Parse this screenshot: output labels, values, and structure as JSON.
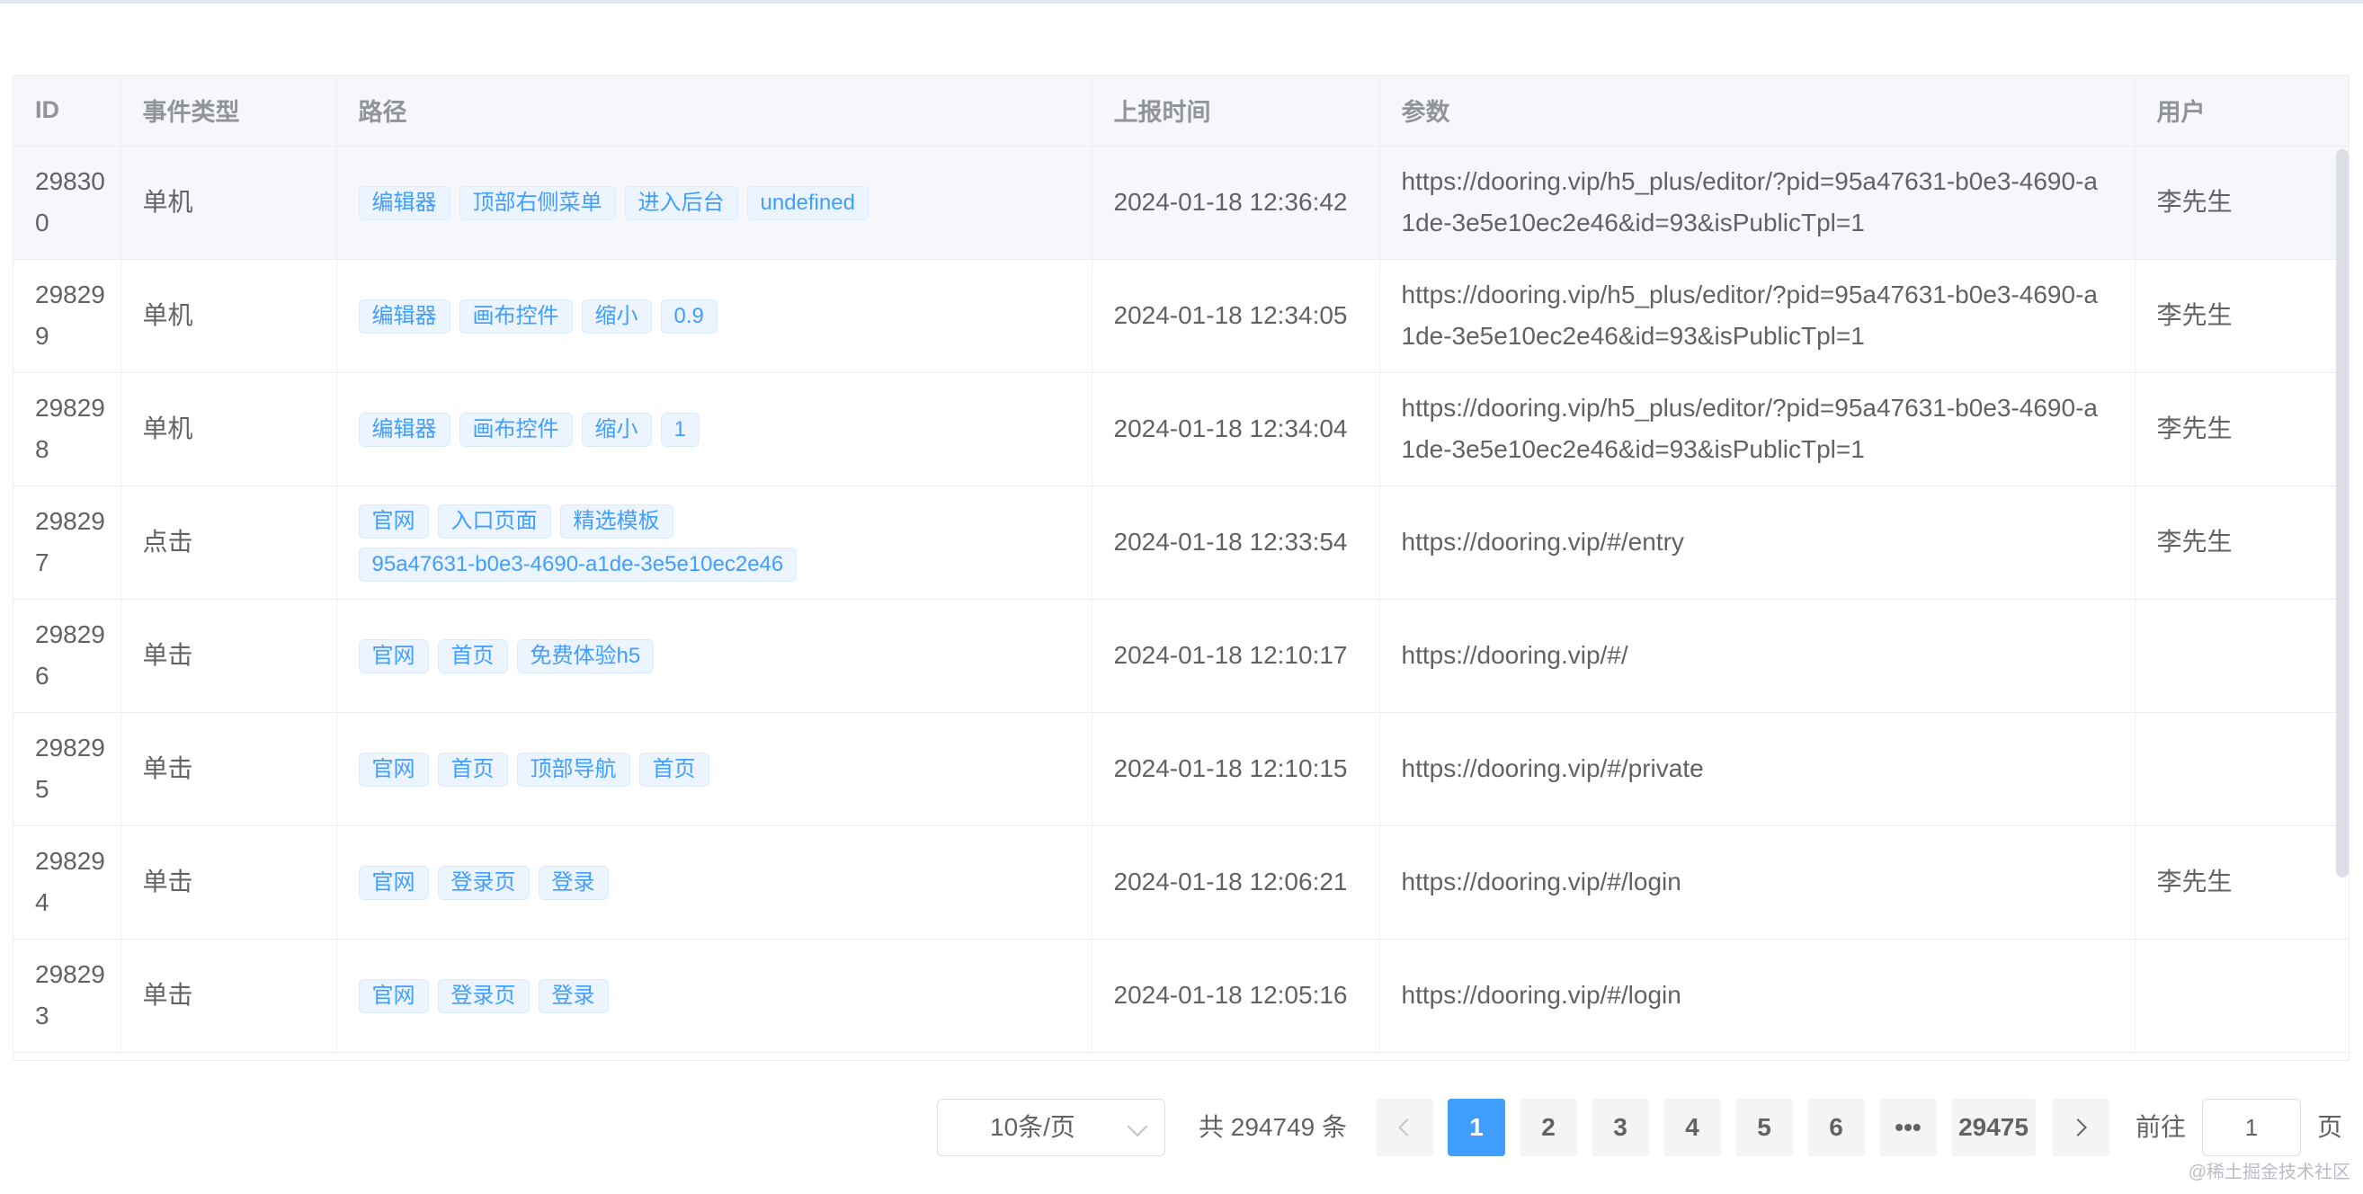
{
  "table": {
    "columns": [
      "ID",
      "事件类型",
      "路径",
      "上报时间",
      "参数",
      "用户"
    ],
    "rows": [
      {
        "id": "298300",
        "type": "单机",
        "path": [
          "编辑器",
          "顶部右侧菜单",
          "进入后台",
          "undefined"
        ],
        "time": "2024-01-18 12:36:42",
        "params": "https://dooring.vip/h5_plus/editor/?pid=95a47631-b0e3-4690-a1de-3e5e10ec2e46&id=93&isPublicTpl=1",
        "user": "李先生"
      },
      {
        "id": "298299",
        "type": "单机",
        "path": [
          "编辑器",
          "画布控件",
          "缩小",
          "0.9"
        ],
        "time": "2024-01-18 12:34:05",
        "params": "https://dooring.vip/h5_plus/editor/?pid=95a47631-b0e3-4690-a1de-3e5e10ec2e46&id=93&isPublicTpl=1",
        "user": "李先生"
      },
      {
        "id": "298298",
        "type": "单机",
        "path": [
          "编辑器",
          "画布控件",
          "缩小",
          "1"
        ],
        "time": "2024-01-18 12:34:04",
        "params": "https://dooring.vip/h5_plus/editor/?pid=95a47631-b0e3-4690-a1de-3e5e10ec2e46&id=93&isPublicTpl=1",
        "user": "李先生"
      },
      {
        "id": "298297",
        "type": "点击",
        "path": [
          "官网",
          "入口页面",
          "精选模板",
          "95a47631-b0e3-4690-a1de-3e5e10ec2e46"
        ],
        "time": "2024-01-18 12:33:54",
        "params": "https://dooring.vip/#/entry",
        "user": "李先生"
      },
      {
        "id": "298296",
        "type": "单击",
        "path": [
          "官网",
          "首页",
          "免费体验h5"
        ],
        "time": "2024-01-18 12:10:17",
        "params": "https://dooring.vip/#/",
        "user": ""
      },
      {
        "id": "298295",
        "type": "单击",
        "path": [
          "官网",
          "首页",
          "顶部导航",
          "首页"
        ],
        "time": "2024-01-18 12:10:15",
        "params": "https://dooring.vip/#/private",
        "user": ""
      },
      {
        "id": "298294",
        "type": "单击",
        "path": [
          "官网",
          "登录页",
          "登录"
        ],
        "time": "2024-01-18 12:06:21",
        "params": "https://dooring.vip/#/login",
        "user": "李先生"
      },
      {
        "id": "298293",
        "type": "单击",
        "path": [
          "官网",
          "登录页",
          "登录"
        ],
        "time": "2024-01-18 12:05:16",
        "params": "https://dooring.vip/#/login",
        "user": ""
      }
    ]
  },
  "pagination": {
    "page_size": "10条/页",
    "total": "共 294749 条",
    "pages": [
      "1",
      "2",
      "3",
      "4",
      "5",
      "6"
    ],
    "ellipsis": "•••",
    "last_page": "29475",
    "current_page": 1,
    "goto_label": "前往",
    "goto_value": "1",
    "page_suffix": "页"
  },
  "watermark": "@稀土掘金技术社区",
  "colors": {
    "accent": "#409eff",
    "header_bg": "#f5f7fa",
    "tag_bg": "#ecf5ff",
    "text": "#606266"
  }
}
